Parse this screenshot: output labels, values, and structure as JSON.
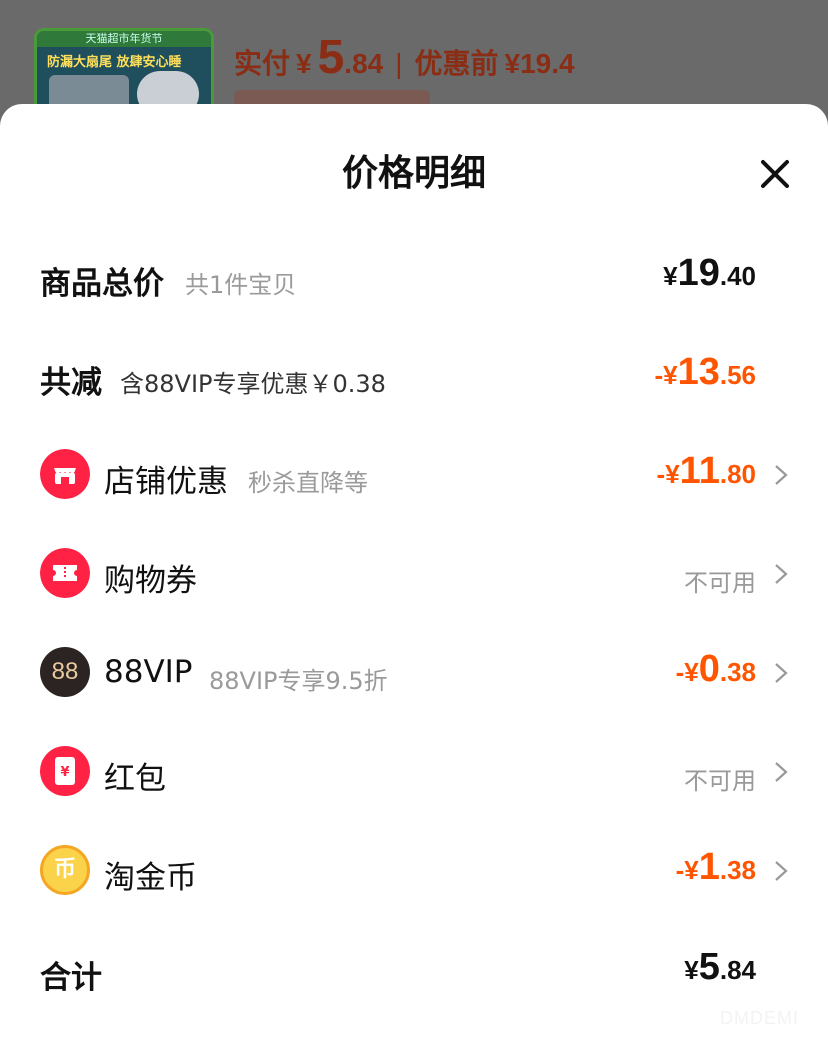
{
  "backdrop": {
    "thumb_band": "天猫超市年货节",
    "thumb_title": "防漏大扇尾 放肆安心睡",
    "paid_label": "实付",
    "paid_currency": "¥",
    "paid_int": "5",
    "paid_dec": ".84",
    "before_label": "优惠前",
    "before_value": "¥19.4"
  },
  "sheet": {
    "title": "价格明细",
    "close_icon": "close-icon"
  },
  "rows": {
    "total": {
      "label": "商品总价",
      "sub": "共1件宝贝",
      "cur": "¥",
      "int": "19",
      "dec": ".40"
    },
    "reduce": {
      "label": "共减",
      "sub": "含88VIP专享优惠￥0.38",
      "cur": "-¥",
      "int": "13",
      "dec": ".56"
    },
    "store": {
      "label": "店铺优惠",
      "sub": "秒杀直降等",
      "cur": "-¥",
      "int": "11",
      "dec": ".80",
      "icon": "store-icon"
    },
    "coupon": {
      "label": "购物券",
      "status": "不可用",
      "icon": "ticket-icon"
    },
    "vip": {
      "label": "88VIP",
      "sub": "88VIP专享9.5折",
      "cur": "-¥",
      "int": "0",
      "dec": ".38",
      "icon": "88vip-icon",
      "icon_text": "88"
    },
    "redpacket": {
      "label": "红包",
      "status": "不可用",
      "icon": "red-packet-icon",
      "icon_text": "¥"
    },
    "coin": {
      "label": "淘金币",
      "cur": "-¥",
      "int": "1",
      "dec": ".38",
      "icon": "coin-icon",
      "icon_text": "币"
    },
    "sum": {
      "label": "合计",
      "cur": "¥",
      "int": "5",
      "dec": ".84"
    }
  },
  "colors": {
    "accent_orange": "#ff5500",
    "icon_red": "#ff2244",
    "vip_dark": "#2b2422",
    "coin_gold": "#f5a623"
  },
  "watermark": "DMDEMI"
}
